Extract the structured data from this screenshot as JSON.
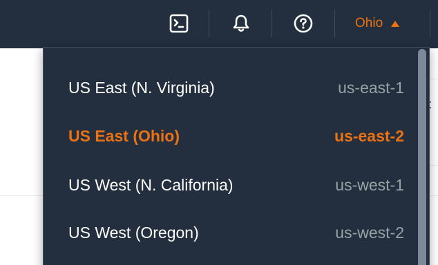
{
  "topnav": {
    "icons": [
      {
        "name": "cloudshell-icon"
      },
      {
        "name": "notifications-icon"
      },
      {
        "name": "help-icon"
      }
    ],
    "region_label": "Ohio"
  },
  "background": {
    "partial_text": "t"
  },
  "region_menu": {
    "items": [
      {
        "name": "US East (N. Virginia)",
        "code": "us-east-1",
        "selected": false
      },
      {
        "name": "US East (Ohio)",
        "code": "us-east-2",
        "selected": true
      },
      {
        "name": "US West (N. California)",
        "code": "us-west-1",
        "selected": false
      },
      {
        "name": "US West (Oregon)",
        "code": "us-west-2",
        "selected": false
      }
    ]
  },
  "colors": {
    "nav_background": "#232f3e",
    "accent_orange": "#ec7211",
    "text_white": "#ffffff",
    "text_muted": "#95a5a6"
  }
}
